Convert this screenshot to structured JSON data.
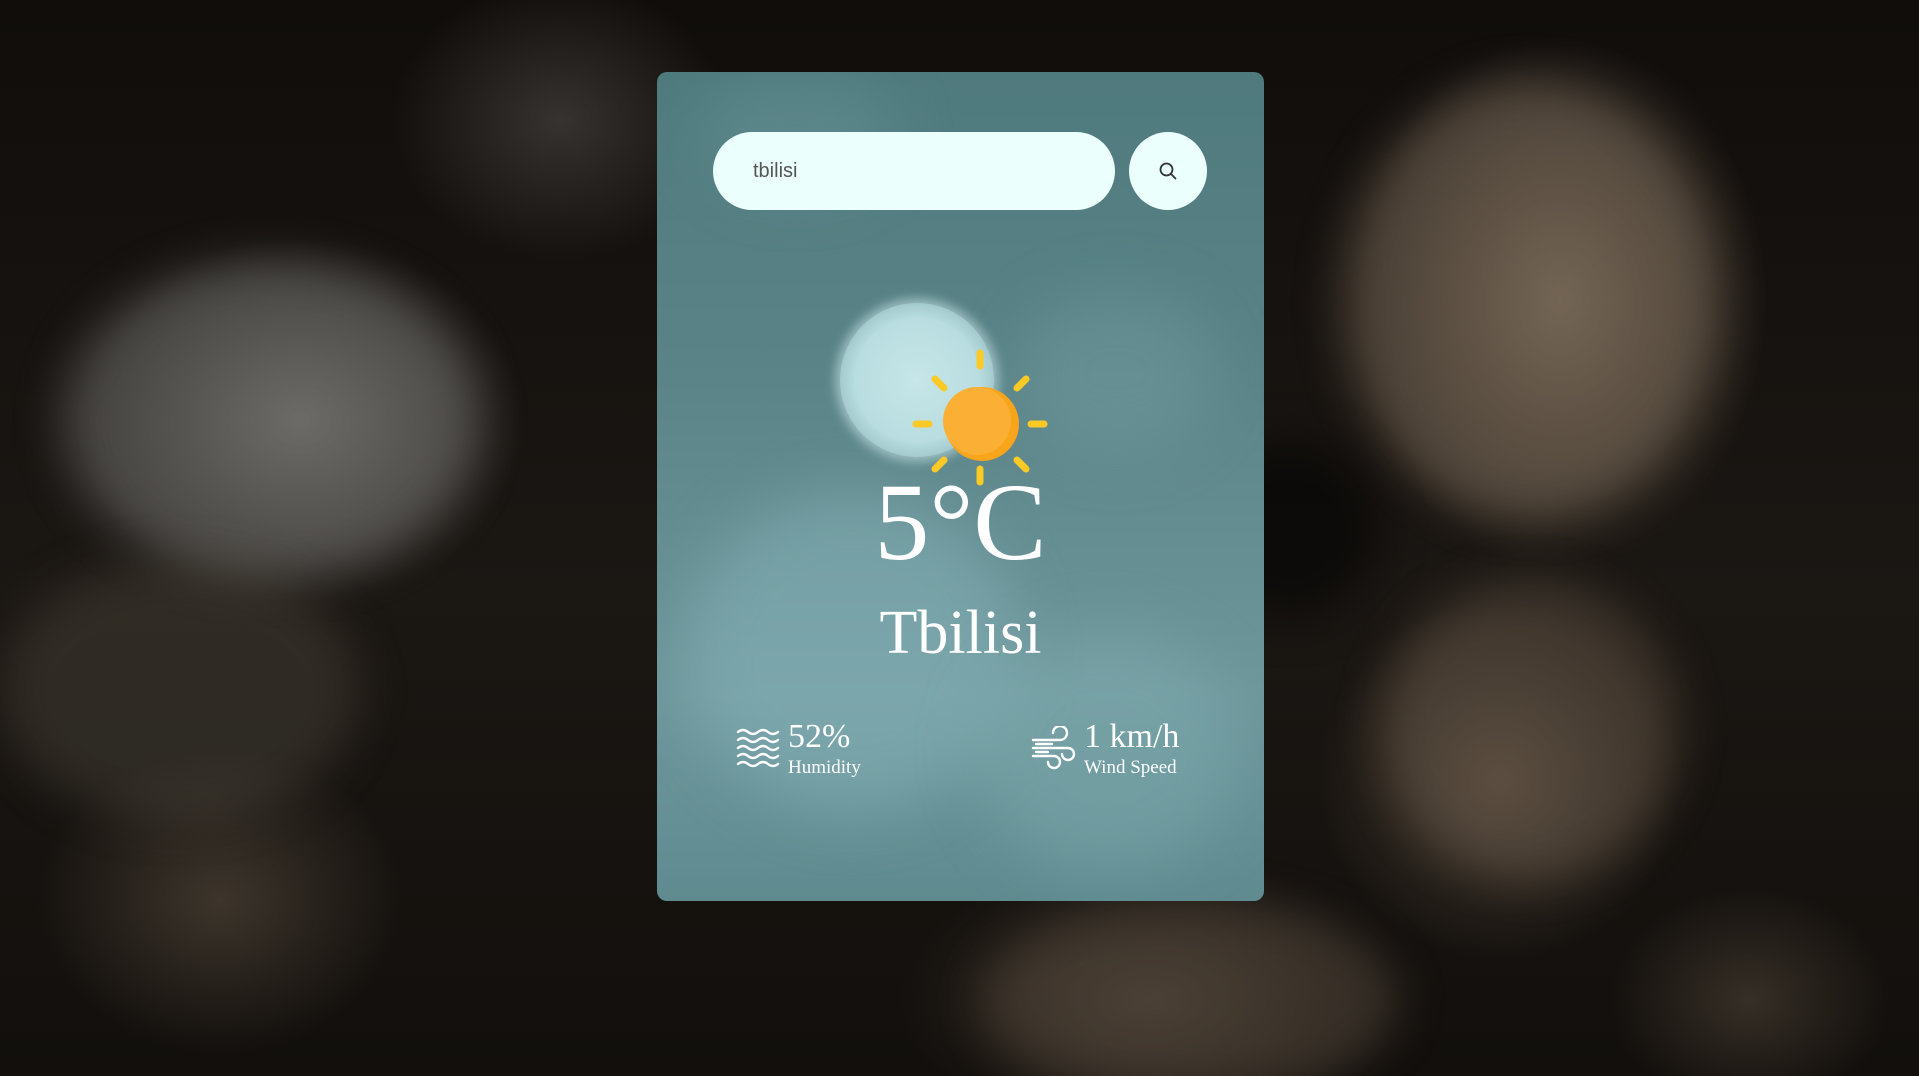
{
  "search": {
    "value": "tbilisi",
    "button_icon": "search-icon"
  },
  "weather": {
    "icon": "sun-icon",
    "temperature": "5°C",
    "city": "Tbilisi"
  },
  "details": {
    "humidity": {
      "icon": "humidity-icon",
      "value": "52%",
      "label": "Humidity"
    },
    "wind": {
      "icon": "wind-icon",
      "value": "1 km/h",
      "label": "Wind Speed"
    }
  },
  "colors": {
    "card": "#5a8387",
    "input_background": "#ebfffc",
    "sun": "#fbab2c",
    "sun_rays": "#fcc925",
    "text": "#ffffff"
  }
}
